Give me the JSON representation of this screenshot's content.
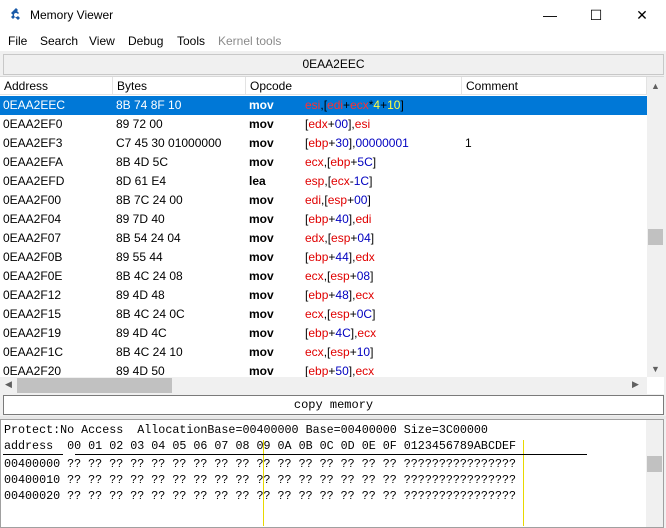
{
  "window": {
    "title": "Memory Viewer",
    "controls": {
      "minimize": "—",
      "maximize": "☐",
      "close": "✕"
    }
  },
  "menu": [
    {
      "label": "File",
      "enabled": true
    },
    {
      "label": "Search",
      "enabled": true
    },
    {
      "label": "View",
      "enabled": true
    },
    {
      "label": "Debug",
      "enabled": true
    },
    {
      "label": "Tools",
      "enabled": true
    },
    {
      "label": "Kernel tools",
      "enabled": false
    }
  ],
  "address_bar": "0EAA2EEC",
  "disassembly": {
    "columns": [
      "Address",
      "Bytes",
      "Opcode",
      "Comment"
    ],
    "selected_row": 0,
    "rows": [
      {
        "address": "0EAA2EEC",
        "bytes": "8B 74 8F 10",
        "mnemonic": "mov",
        "operands": "esi,[edi+ecx*4+10]",
        "comment": ""
      },
      {
        "address": "0EAA2EF0",
        "bytes": "89 72 00",
        "mnemonic": "mov",
        "operands": "[edx+00],esi",
        "comment": ""
      },
      {
        "address": "0EAA2EF3",
        "bytes": "C7 45 30 01000000",
        "mnemonic": "mov",
        "operands": "[ebp+30],00000001",
        "comment": "1"
      },
      {
        "address": "0EAA2EFA",
        "bytes": "8B 4D 5C",
        "mnemonic": "mov",
        "operands": "ecx,[ebp+5C]",
        "comment": ""
      },
      {
        "address": "0EAA2EFD",
        "bytes": "8D 61 E4",
        "mnemonic": "lea",
        "operands": "esp,[ecx-1C]",
        "comment": ""
      },
      {
        "address": "0EAA2F00",
        "bytes": "8B 7C 24 00",
        "mnemonic": "mov",
        "operands": "edi,[esp+00]",
        "comment": ""
      },
      {
        "address": "0EAA2F04",
        "bytes": "89 7D 40",
        "mnemonic": "mov",
        "operands": "[ebp+40],edi",
        "comment": ""
      },
      {
        "address": "0EAA2F07",
        "bytes": "8B 54 24 04",
        "mnemonic": "mov",
        "operands": "edx,[esp+04]",
        "comment": ""
      },
      {
        "address": "0EAA2F0B",
        "bytes": "89 55 44",
        "mnemonic": "mov",
        "operands": "[ebp+44],edx",
        "comment": ""
      },
      {
        "address": "0EAA2F0E",
        "bytes": "8B 4C 24 08",
        "mnemonic": "mov",
        "operands": "ecx,[esp+08]",
        "comment": ""
      },
      {
        "address": "0EAA2F12",
        "bytes": "89 4D 48",
        "mnemonic": "mov",
        "operands": "[ebp+48],ecx",
        "comment": ""
      },
      {
        "address": "0EAA2F15",
        "bytes": "8B 4C 24 0C",
        "mnemonic": "mov",
        "operands": "ecx,[esp+0C]",
        "comment": ""
      },
      {
        "address": "0EAA2F19",
        "bytes": "89 4D 4C",
        "mnemonic": "mov",
        "operands": "[ebp+4C],ecx",
        "comment": ""
      },
      {
        "address": "0EAA2F1C",
        "bytes": "8B 4C 24 10",
        "mnemonic": "mov",
        "operands": "ecx,[esp+10]",
        "comment": ""
      },
      {
        "address": "0EAA2F20",
        "bytes": "89 4D 50",
        "mnemonic": "mov",
        "operands": "[ebp+50],ecx",
        "comment": ""
      }
    ]
  },
  "copy_memory_label": "copy memory",
  "hex_view": {
    "info_line": "Protect:No Access  AllocationBase=00400000 Base=00400000 Size=3C00000",
    "header_line": "address  00 01 02 03 04 05 06 07 08 09 0A 0B 0C 0D 0E 0F 0123456789ABCDEF",
    "rows": [
      "00400000 ?? ?? ?? ?? ?? ?? ?? ?? ?? ?? ?? ?? ?? ?? ?? ?? ????????????????",
      "00400010 ?? ?? ?? ?? ?? ?? ?? ?? ?? ?? ?? ?? ?? ?? ?? ?? ????????????????",
      "00400020 ?? ?? ?? ?? ?? ?? ?? ?? ?? ?? ?? ?? ?? ?? ?? ?? ????????????????"
    ]
  },
  "colors": {
    "selection": "#0078d7",
    "register": "#e00000",
    "number": "#0000c0",
    "hex_separator": "#e8d800"
  }
}
